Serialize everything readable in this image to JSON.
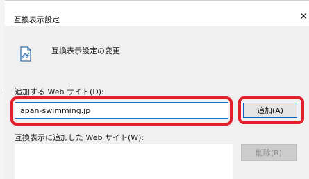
{
  "window": {
    "title": "互換表示設定"
  },
  "header": {
    "heading": "互換表示設定の変更",
    "icon": "compat-view-icon"
  },
  "add_site": {
    "label": "追加する Web サイト(D):",
    "input_value": "japan-swimming.jp",
    "add_button_label": "追加(A)"
  },
  "site_list": {
    "label": "互換表示に追加した Web サイト(W):",
    "remove_button_label": "削除(R)"
  },
  "colors": {
    "highlight": "#e0202a",
    "focus": "#1e6ec8",
    "panel": "#f0f0f0"
  }
}
